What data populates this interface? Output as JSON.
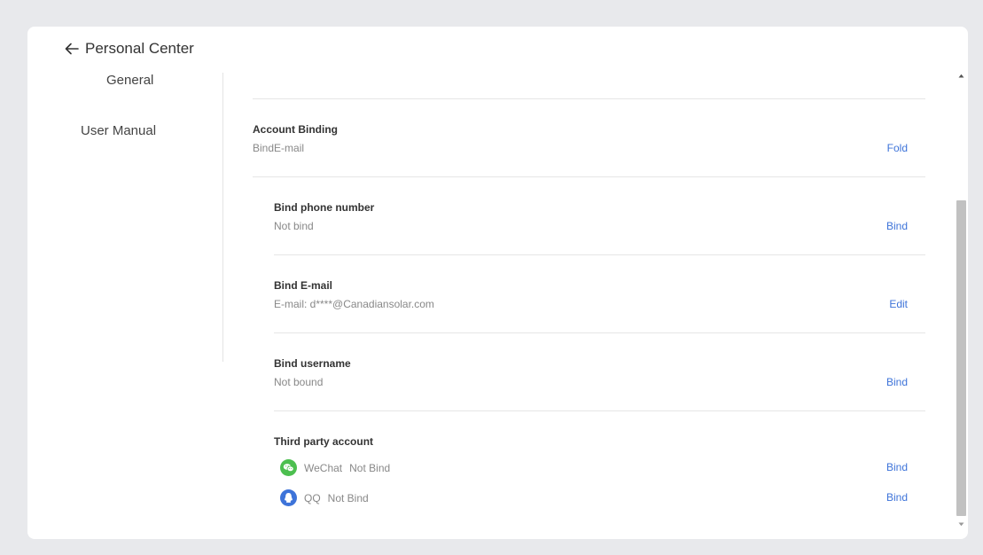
{
  "header": {
    "title": "Personal Center",
    "back_icon": "arrow-left-icon"
  },
  "sidebar": {
    "items": [
      {
        "label": "General"
      },
      {
        "label": "User Manual"
      }
    ]
  },
  "account_binding": {
    "title": "Account Binding",
    "subtitle": "BindE-mail",
    "action": "Fold"
  },
  "phone": {
    "title": "Bind phone number",
    "subtitle": "Not bind",
    "action": "Bind"
  },
  "email": {
    "title": "Bind E-mail",
    "subtitle": "E-mail: d****@Canadiansolar.com",
    "action": "Edit"
  },
  "username": {
    "title": "Bind username",
    "subtitle": "Not bound",
    "action": "Bind"
  },
  "third_party": {
    "title": "Third party account",
    "accounts": [
      {
        "name": "WeChat",
        "status": "Not Bind",
        "action": "Bind",
        "icon": "wechat-icon",
        "color": "#4cbf4f"
      },
      {
        "name": "QQ",
        "status": "Not Bind",
        "action": "Bind",
        "icon": "qq-icon",
        "color": "#3d73d9"
      }
    ]
  },
  "colors": {
    "accent": "#3d73d9",
    "background": "#e8e9ec"
  }
}
